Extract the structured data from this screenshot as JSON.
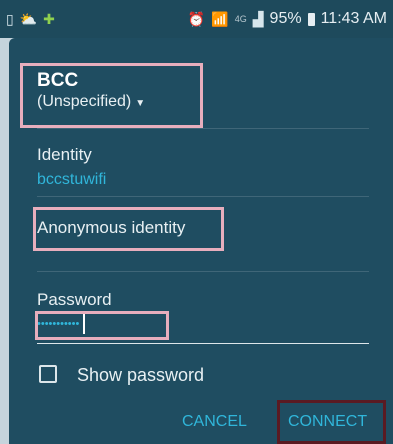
{
  "status_bar": {
    "left_icons": [
      "notification-icon",
      "weather-icon",
      "android-icon"
    ],
    "right_icons": [
      "alarm-icon",
      "wifi-icon",
      "signal-icon"
    ],
    "network_label": "4G",
    "battery": "95%",
    "time": "11:43 AM"
  },
  "dialog": {
    "title": "BCC",
    "eap_method": "(Unspecified)",
    "identity_label": "Identity",
    "identity_value": "bccstuwifi",
    "anonymous_identity_label": "Anonymous identity",
    "password_label": "Password",
    "password_value": "•••••••••••",
    "show_password_label": "Show password",
    "show_password_checked": false,
    "cancel_label": "CANCEL",
    "connect_label": "CONNECT"
  },
  "colors": {
    "background": "#1f4d61",
    "accent": "#30b6da",
    "highlight": "#e7aebd",
    "connect_highlight": "#5a1a22"
  }
}
